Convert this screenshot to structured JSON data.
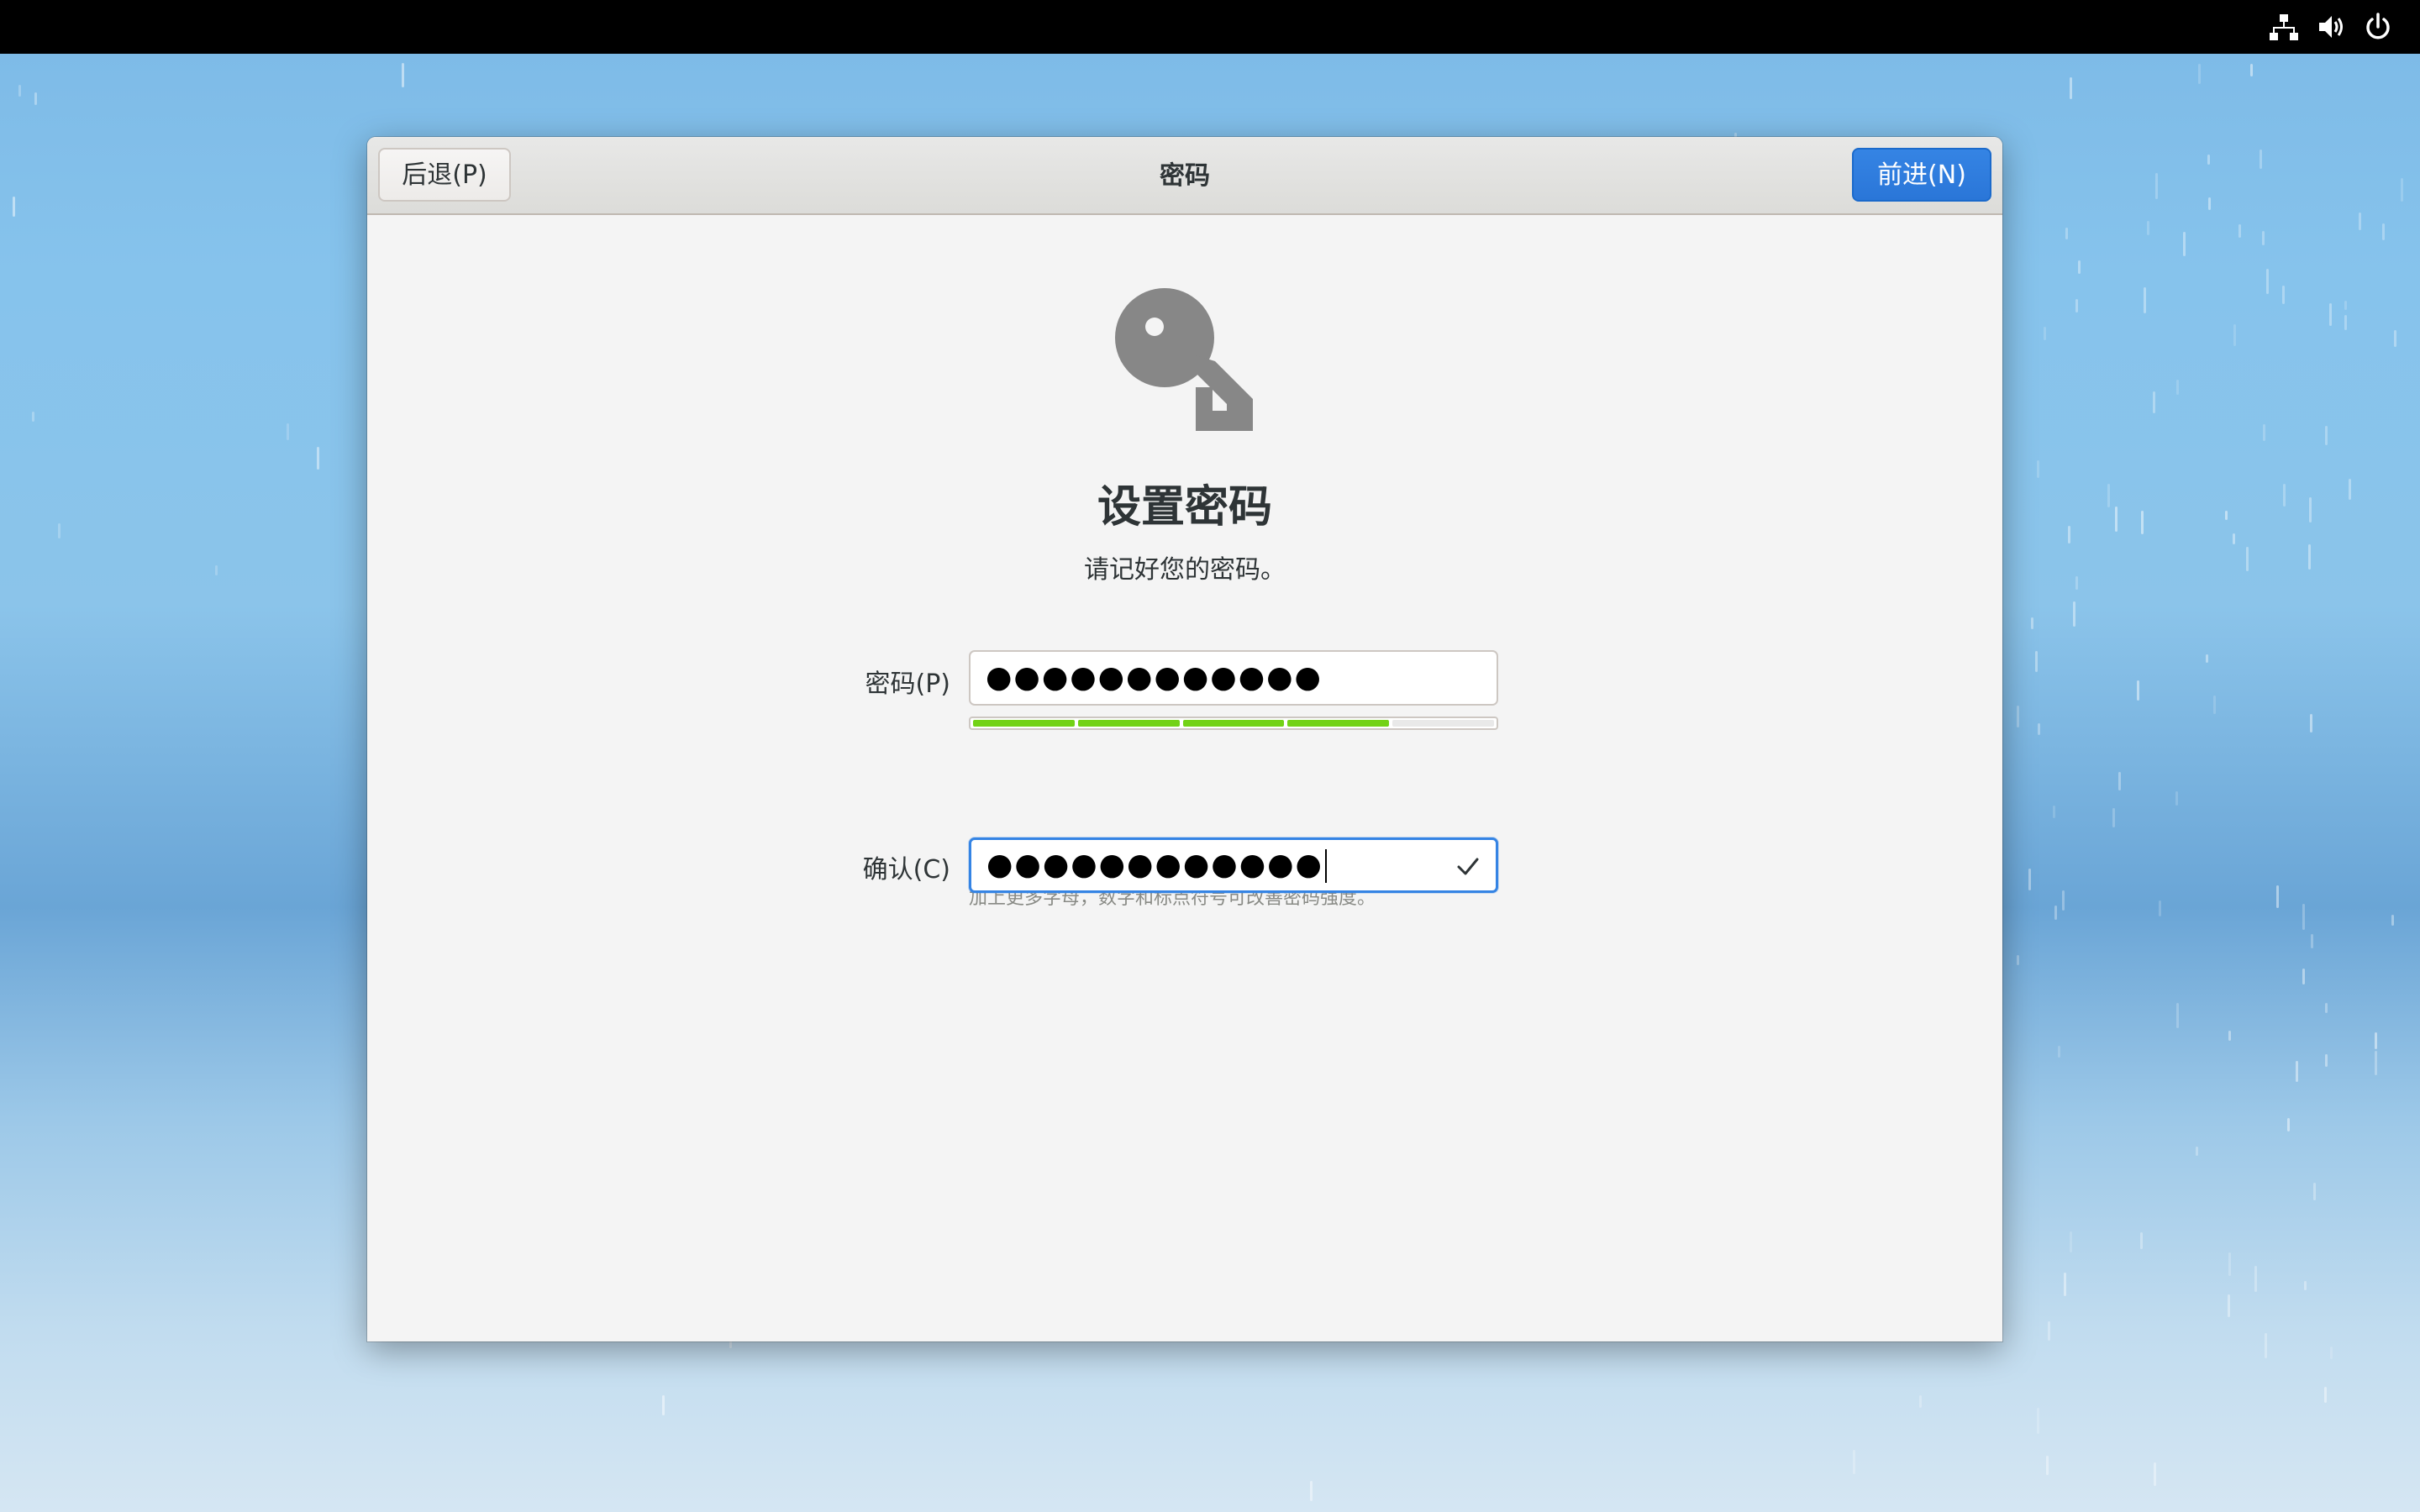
{
  "topbar": {
    "icons": [
      "network-wired-icon",
      "volume-icon",
      "power-icon"
    ]
  },
  "window": {
    "title": "密码",
    "back_label": "后退(P)",
    "next_label": "前进(N)"
  },
  "page": {
    "icon": "key-icon",
    "heading": "设置密码",
    "subheading": "请记好您的密码。"
  },
  "form": {
    "password": {
      "label": "密码(P)",
      "value_masked": "●●●●●●●●●●●●",
      "strength_level": 0.8,
      "strength_segments": 5,
      "strength_hint": "加上更多字母，数字和标点符号可改善密码强度。"
    },
    "confirm": {
      "label": "确认(C)",
      "value_masked": "●●●●●●●●●●●●",
      "status_icon": "checkmark-icon"
    }
  },
  "colors": {
    "accent": "#3584e4",
    "strength_bar": "#73d216",
    "topbar": "#000000"
  }
}
